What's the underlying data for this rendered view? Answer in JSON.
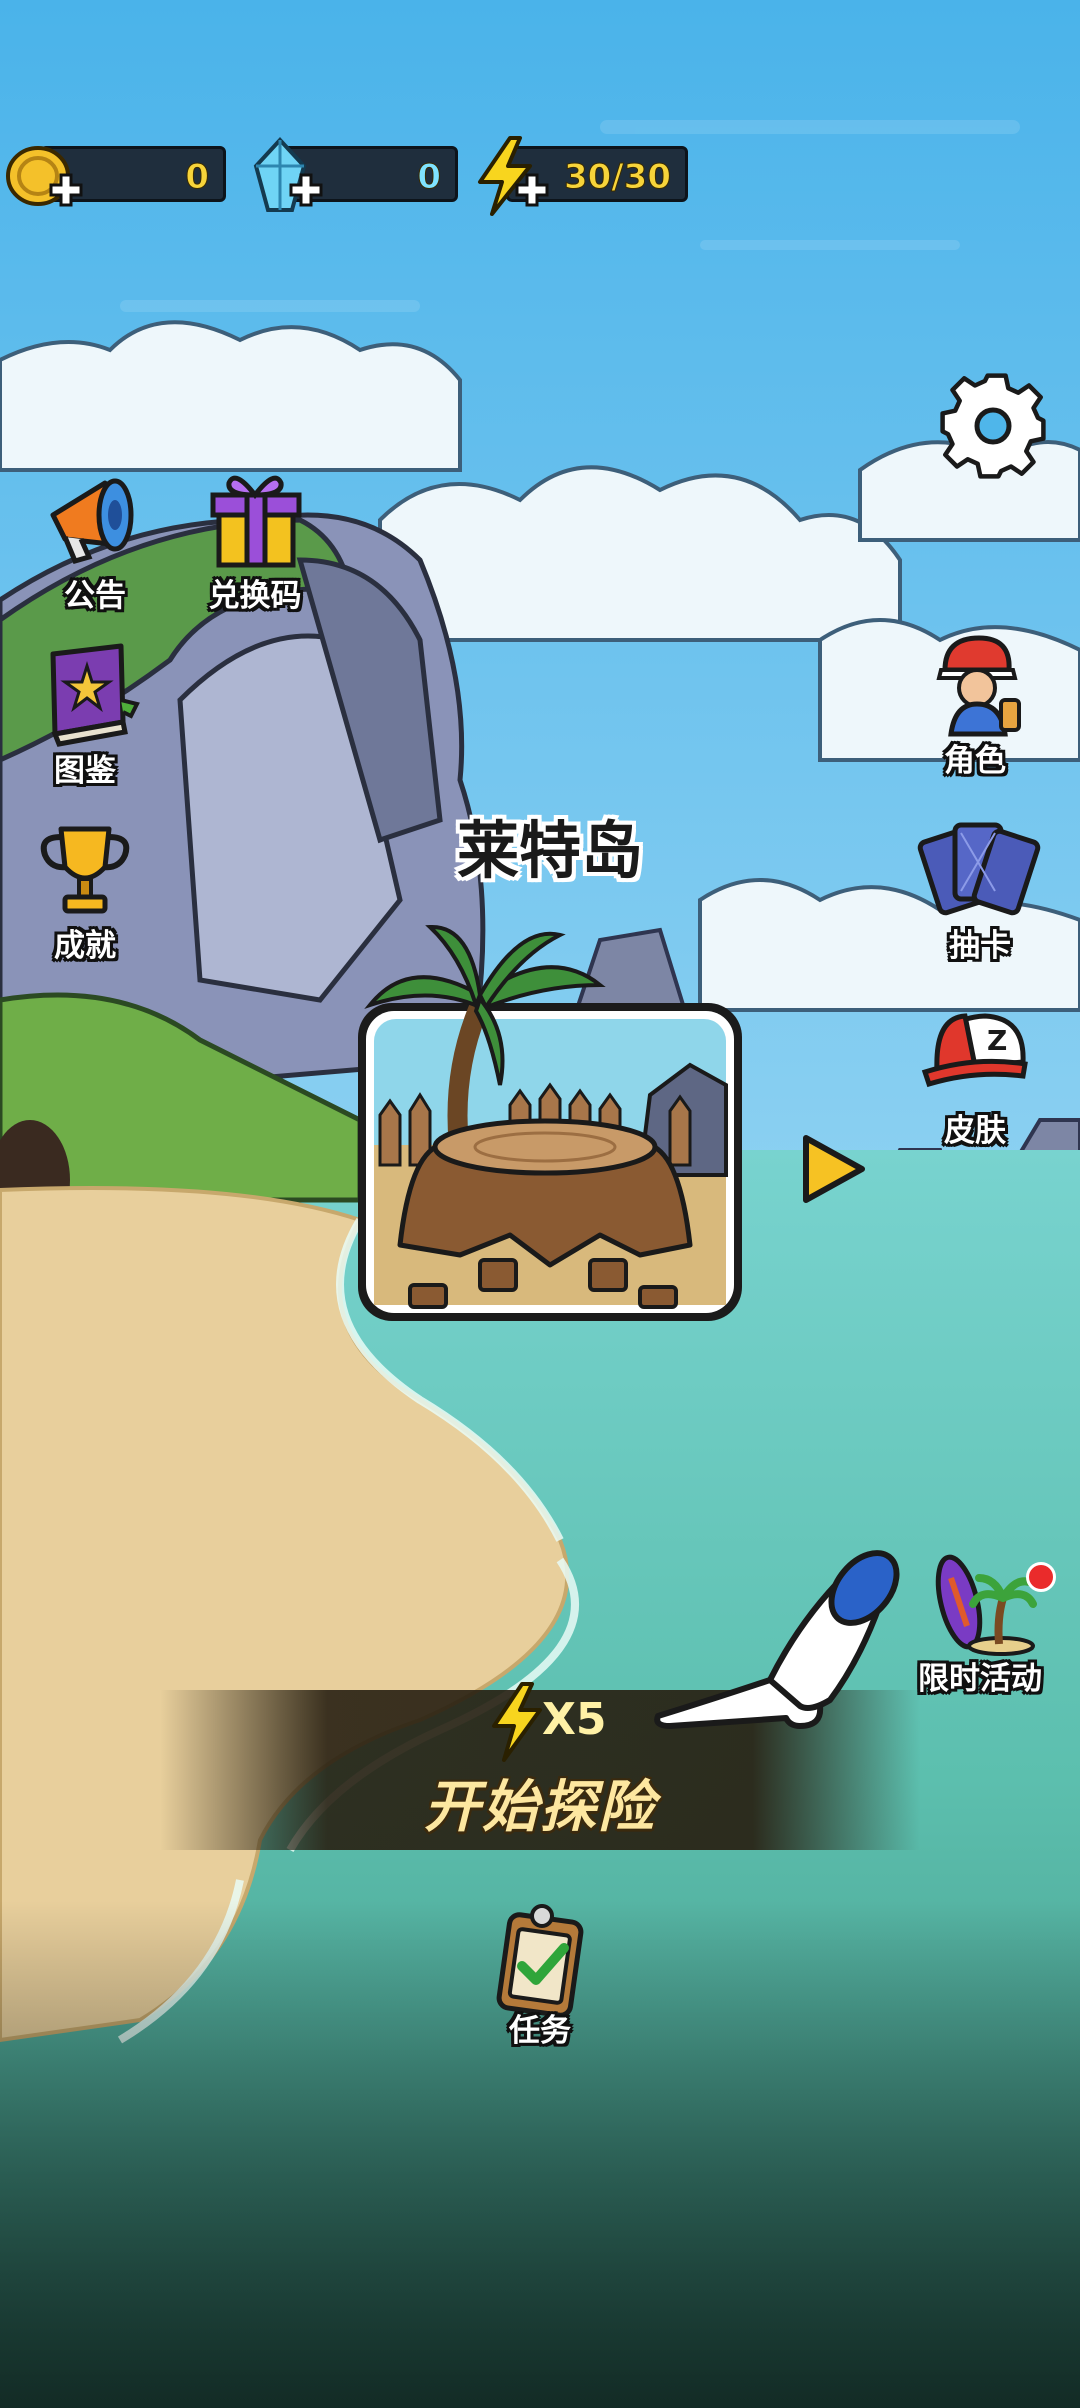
{
  "resources": {
    "coins": "0",
    "gems": "0",
    "energy": "30/30"
  },
  "left_menu": {
    "announcement": "公告",
    "redeem_code": "兑换码",
    "codex": "图鉴",
    "achievements": "成就"
  },
  "right_menu": {
    "character": "角色",
    "draw_card": "抽卡",
    "skin": "皮肤",
    "limited_event": "限时活动"
  },
  "level": {
    "island_name": "莱特岛"
  },
  "start": {
    "cost": "X5",
    "label": "开始探险"
  },
  "bottom": {
    "tasks": "任务"
  },
  "colors": {
    "sky": "#4fb6ea",
    "sea": "#5fc6b8",
    "sand": "#e8cf9c",
    "value_yellow": "#f7d43a",
    "notify_red": "#ea2b2b"
  },
  "icons": [
    "coin-icon",
    "gem-icon",
    "energy-icon",
    "plus-icon",
    "settings-gear-icon",
    "megaphone-icon",
    "gift-box-icon",
    "book-icon",
    "trophy-icon",
    "character-icon",
    "cards-icon",
    "cap-icon",
    "surfboard-palm-icon",
    "clipboard-icon",
    "play-arrow-icon",
    "pointing-hand-icon",
    "lightning-icon"
  ]
}
